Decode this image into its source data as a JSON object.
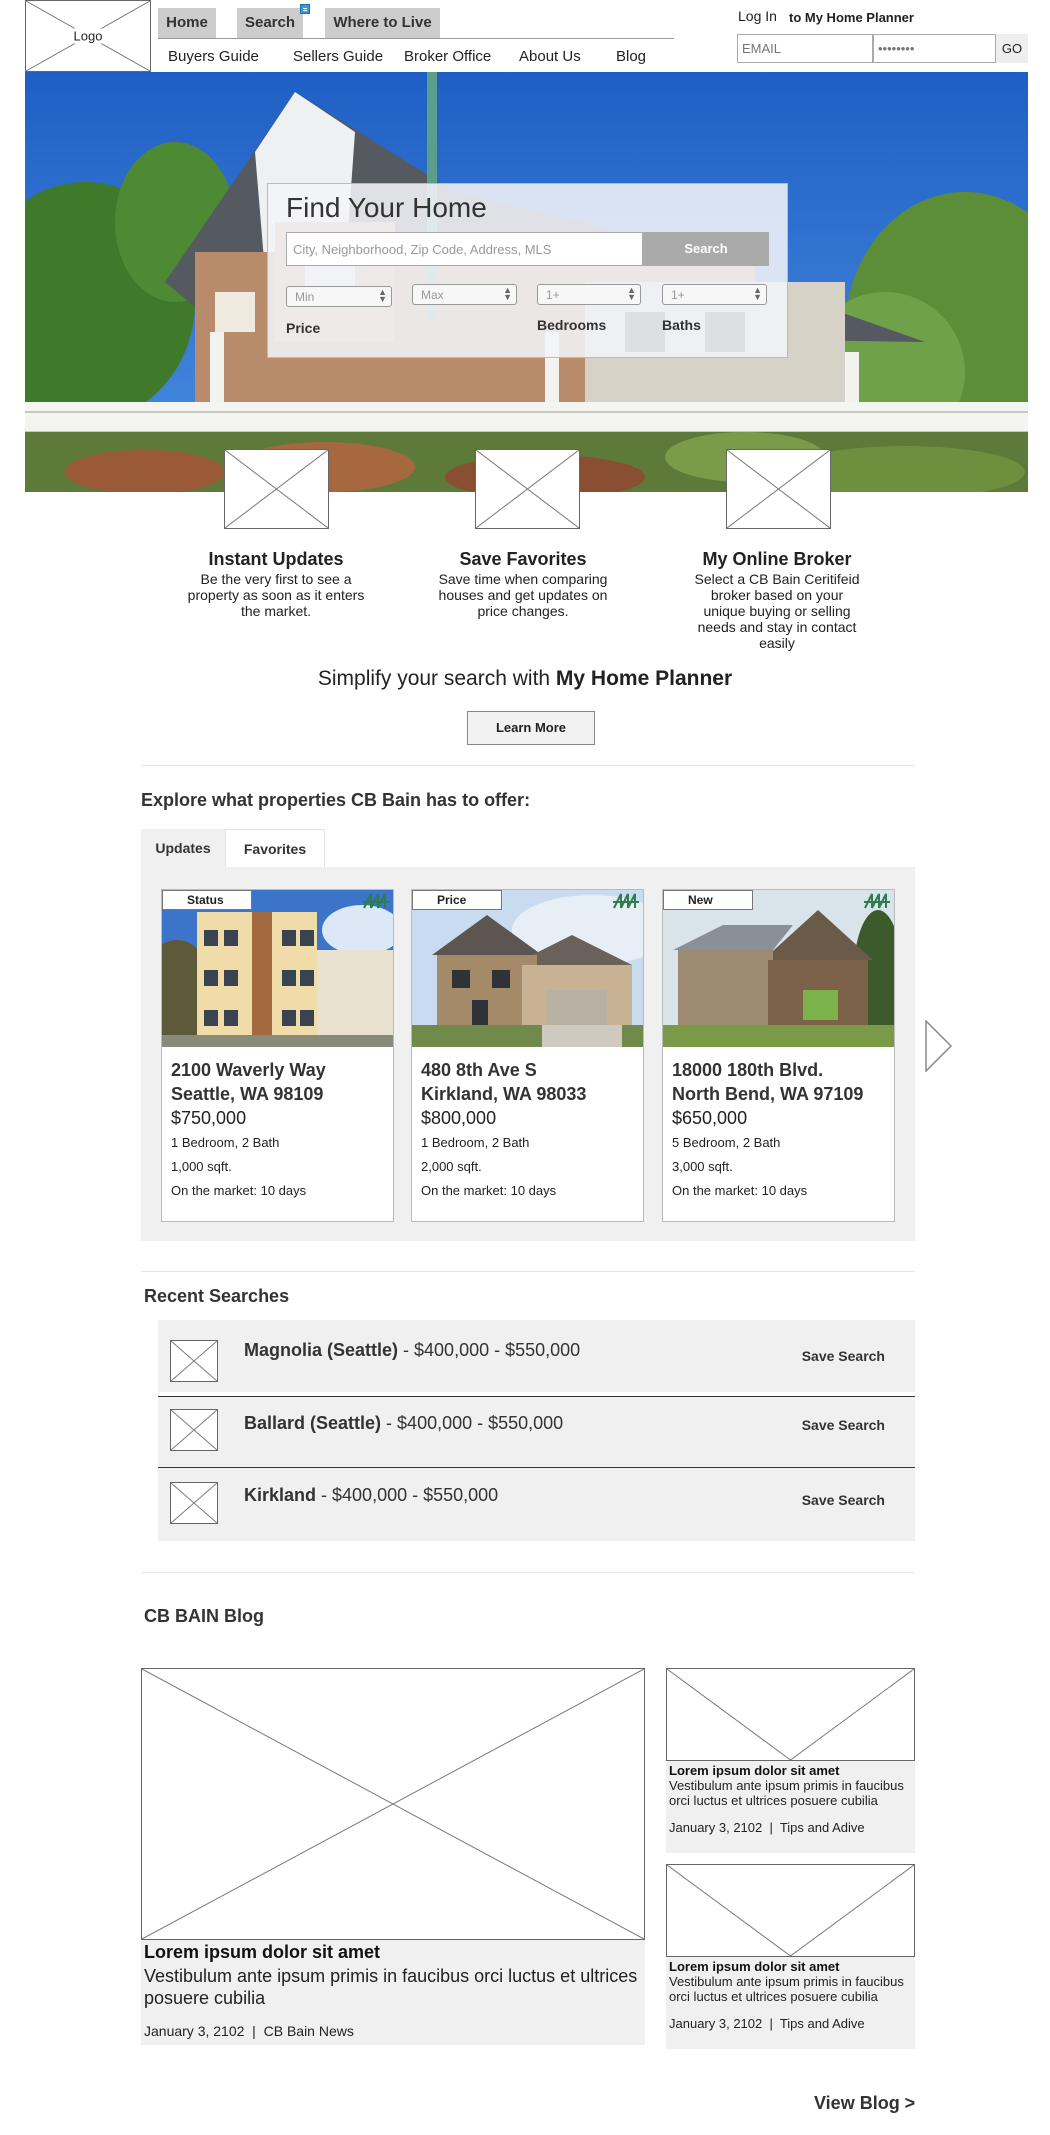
{
  "header": {
    "logo_label": "Logo",
    "tabs": [
      {
        "label": "Home"
      },
      {
        "label": "Search"
      },
      {
        "label": "Where to Live"
      }
    ],
    "subnav": [
      {
        "label": "Buyers Guide"
      },
      {
        "label": "Sellers Guide"
      },
      {
        "label": "Broker Office"
      },
      {
        "label": "About Us"
      },
      {
        "label": "Blog"
      }
    ],
    "login": {
      "login_link": "Log In",
      "login_suffix": "to My Home Planner",
      "email_placeholder": "EMAIL",
      "password_placeholder": "••••••••",
      "go_label": "GO"
    }
  },
  "hero": {
    "title": "Find Your Home",
    "search_placeholder": "City, Neighborhood, Zip Code, Address, MLS",
    "search_button": "Search",
    "price_min": "Min",
    "price_max": "Max",
    "price_label": "Price",
    "bedrooms_value": "1+",
    "bedrooms_label": "Bedrooms",
    "baths_value": "1+",
    "baths_label": "Baths"
  },
  "features": [
    {
      "title": "Instant Updates",
      "desc": "Be the very first to see a property as soon as it enters the market."
    },
    {
      "title": "Save Favorites",
      "desc": "Save time when comparing houses and get updates on price changes."
    },
    {
      "title": "My Online Broker",
      "desc": "Select a CB Bain Ceritifeid broker based on your unique buying or selling needs and stay in contact easily"
    }
  ],
  "planner": {
    "text": "Simplify your search with ",
    "brand": "My Home Planner",
    "button": "Learn More"
  },
  "explore": {
    "title": "Explore what properties CB Bain has to offer:",
    "tabs": [
      {
        "label": "Updates"
      },
      {
        "label": "Favorites"
      }
    ],
    "cards": [
      {
        "badge": "Status",
        "street": "2100 Waverly Way",
        "city": "Seattle, WA 98109",
        "price": "$750,000",
        "rooms": "1 Bedroom, 2 Bath",
        "sqft": "1,000 sqft.",
        "market": "On the market: 10 days"
      },
      {
        "badge": "Price",
        "street": "480 8th Ave S",
        "city": "Kirkland, WA 98033",
        "price": "$800,000",
        "rooms": "1 Bedroom, 2 Bath",
        "sqft": "2,000 sqft.",
        "market": "On the market: 10 days"
      },
      {
        "badge": "New",
        "street": "18000 180th Blvd.",
        "city": "North Bend, WA 97109",
        "price": "$650,000",
        "rooms": "5 Bedroom, 2 Bath",
        "sqft": "3,000 sqft.",
        "market": "On the market: 10 days"
      }
    ]
  },
  "recent": {
    "title": "Recent Searches",
    "items": [
      {
        "place": "Magnolia (Seattle)",
        "range": " - $400,000 - $550,000",
        "action": "Save Search"
      },
      {
        "place": "Ballard (Seattle)",
        "range": " - $400,000 - $550,000",
        "action": "Save Search"
      },
      {
        "place": "Kirkland",
        "range": " - $400,000 - $550,000",
        "action": "Save Search"
      }
    ]
  },
  "blog": {
    "title": "CB BAIN Blog",
    "main": {
      "headline": "Lorem ipsum dolor sit amet",
      "desc": "Vestibulum ante ipsum primis in faucibus orci luctus et ultrices posuere cubilia",
      "meta": "January 3, 2102  |  CB Bain News"
    },
    "side": [
      {
        "headline": "Lorem ipsum dolor sit amet",
        "desc": "Vestibulum ante ipsum primis in faucibus orci luctus et ultrices posuere cubilia",
        "meta": "January 3, 2102  |  Tips and Adive"
      },
      {
        "headline": "Lorem ipsum dolor sit amet",
        "desc": "Vestibulum ante ipsum primis in faucibus orci luctus et ultrices posuere cubilia",
        "meta": "January 3, 2102  |  Tips and Adive"
      }
    ],
    "view_all": "View Blog >"
  },
  "colors": {
    "accent_green": "#2e7d4f",
    "notify_blue": "#3a9ad9",
    "panel_gray": "#f0f0f0"
  }
}
